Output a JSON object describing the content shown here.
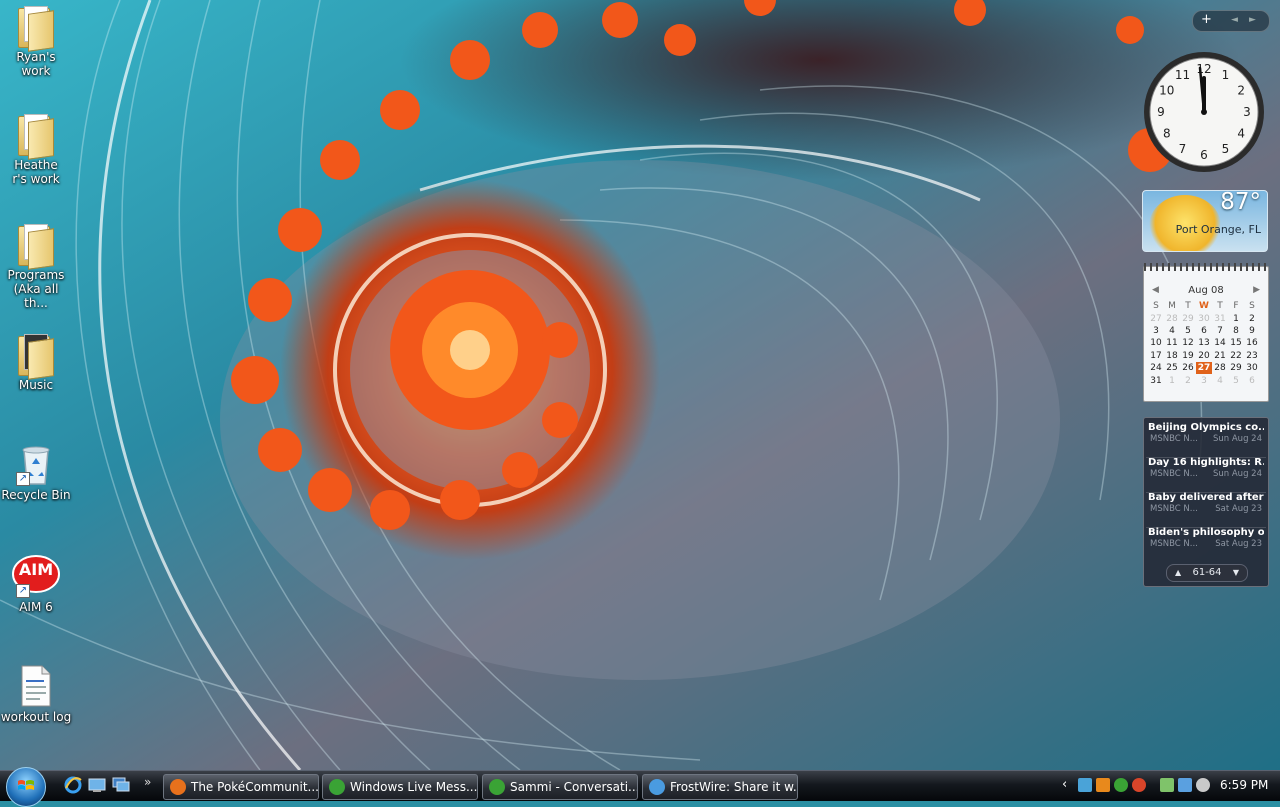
{
  "desktop": {
    "icons": [
      {
        "label": "Ryan's work",
        "type": "folder"
      },
      {
        "label": "Heather's work",
        "type": "folder"
      },
      {
        "label": "Programs (Aka all th...",
        "type": "folder"
      },
      {
        "label": "Music",
        "type": "folder"
      },
      {
        "label": "Recycle Bin",
        "type": "recycle-bin"
      },
      {
        "label": "AIM 6",
        "type": "aim"
      },
      {
        "label": "workout log",
        "type": "document"
      }
    ],
    "aim_text": "AIM"
  },
  "sidebar": {
    "add_symbol": "+",
    "prev_symbol": "◄",
    "next_symbol": "►"
  },
  "clock": {
    "numerals": [
      "12",
      "1",
      "2",
      "3",
      "4",
      "5",
      "6",
      "7",
      "8",
      "9",
      "10",
      "11"
    ],
    "time": "6:59"
  },
  "weather": {
    "temperature": "87°",
    "city": "Port Orange, FL"
  },
  "calendar": {
    "month": "Aug 08",
    "weekdays": [
      "S",
      "M",
      "T",
      "W",
      "T",
      "F",
      "S"
    ],
    "today_weekday_index": 3,
    "today": "27",
    "weeks": [
      [
        "27",
        "28",
        "29",
        "30",
        "31",
        "1",
        "2"
      ],
      [
        "3",
        "4",
        "5",
        "6",
        "7",
        "8",
        "9"
      ],
      [
        "10",
        "11",
        "12",
        "13",
        "14",
        "15",
        "16"
      ],
      [
        "17",
        "18",
        "19",
        "20",
        "21",
        "22",
        "23"
      ],
      [
        "24",
        "25",
        "26",
        "27",
        "28",
        "29",
        "30"
      ],
      [
        "31",
        "1",
        "2",
        "3",
        "4",
        "5",
        "6"
      ]
    ]
  },
  "news": {
    "items": [
      {
        "title": "Beijing Olympics co...",
        "source": "MSNBC N...",
        "date": "Sun Aug 24"
      },
      {
        "title": "Day 16 highlights: R...",
        "source": "MSNBC N...",
        "date": "Sun Aug 24"
      },
      {
        "title": "Baby delivered after ...",
        "source": "MSNBC N...",
        "date": "Sat Aug 23"
      },
      {
        "title": "Biden's philosophy o...",
        "source": "MSNBC N...",
        "date": "Sat Aug 23"
      }
    ],
    "pager": "61-64"
  },
  "taskbar": {
    "quick_launch_more": "»",
    "buttons": [
      {
        "label": "The PokéCommunit...",
        "icon": "firefox-icon",
        "color": "#e8711c"
      },
      {
        "label": "Windows Live Mess...",
        "icon": "messenger-icon",
        "color": "#3aa335"
      },
      {
        "label": "Sammi - Conversati...",
        "icon": "conversation-icon",
        "color": "#3aa335"
      },
      {
        "label": "FrostWire: Share it w...",
        "icon": "frostwire-icon",
        "color": "#4a9be0"
      }
    ],
    "tray_chevron": "‹",
    "clock": "6:59 PM"
  },
  "colors": {
    "wallpaper_teal": "#2a8fa3",
    "fractal_orange": "#f2571a",
    "calendar_today": "#e0621a"
  }
}
